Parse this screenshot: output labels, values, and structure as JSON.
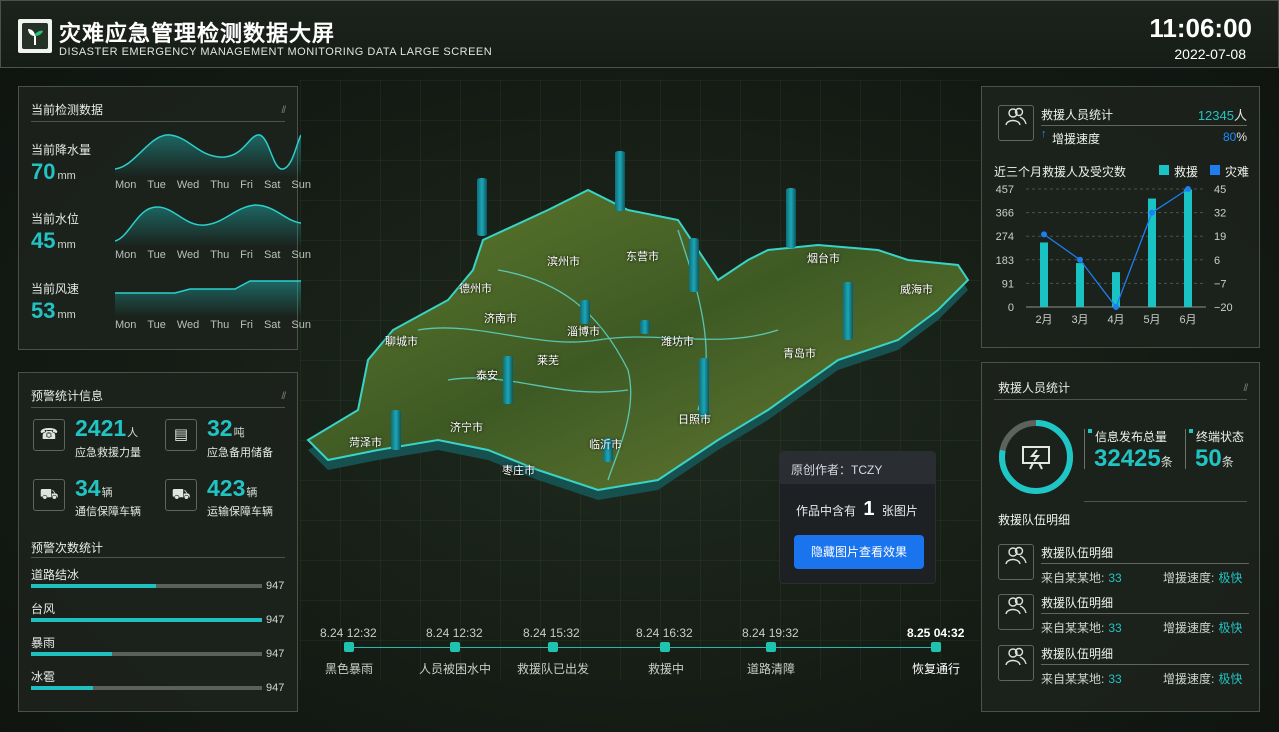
{
  "header": {
    "title": "灾难应急管理检测数据大屏",
    "subtitle": "DISASTER EMERGENCY MANAGEMENT MONITORING DATA LARGE SCREEN",
    "time": "11:06:00",
    "date": "2022-07-08"
  },
  "monitor": {
    "title": "当前检测数据",
    "deco": "//",
    "days": [
      "Mon",
      "Tue",
      "Wed",
      "Thu",
      "Fri",
      "Sat",
      "Sun"
    ],
    "items": [
      {
        "label": "当前降水量",
        "value": "70",
        "unit": "mm"
      },
      {
        "label": "当前水位",
        "value": "45",
        "unit": "mm"
      },
      {
        "label": "当前风速",
        "value": "53",
        "unit": "mm"
      }
    ]
  },
  "warning": {
    "title": "预警统计信息",
    "deco": "//",
    "stats": [
      {
        "icon": "phone-icon",
        "glyph": "☎",
        "value": "2421",
        "unit": "人",
        "label": "应急救援力量"
      },
      {
        "icon": "clipboard-icon",
        "glyph": "▤",
        "value": "32",
        "unit": "吨",
        "label": "应急备用储备"
      },
      {
        "icon": "car-icon",
        "glyph": "⛟",
        "value": "34",
        "unit": "辆",
        "label": "通信保障车辆"
      },
      {
        "icon": "truck-icon",
        "glyph": "⛟",
        "value": "423",
        "unit": "辆",
        "label": "运输保障车辆"
      }
    ],
    "count_title": "预警次数统计",
    "counts": [
      {
        "label": "道路结冰",
        "value": "947",
        "fill": 0.54
      },
      {
        "label": "台风",
        "value": "947",
        "fill": 1.0
      },
      {
        "label": "暴雨",
        "value": "947",
        "fill": 0.35
      },
      {
        "label": "冰雹",
        "value": "947",
        "fill": 0.27
      }
    ]
  },
  "map": {
    "labels": [
      "滨州市",
      "东营市",
      "烟台市",
      "威海市",
      "德州市",
      "济南市",
      "淄博市",
      "潍坊市",
      "聊城市",
      "莱芜",
      "泰安",
      "青岛市",
      "日照市",
      "菏泽市",
      "济宁市",
      "临沂市",
      "枣庄市"
    ]
  },
  "timeline": {
    "times": [
      "8.24 12:32",
      "8.24 12:32",
      "8.24 15:32",
      "8.24 16:32",
      "8.24 19:32",
      "8.25 04:32"
    ],
    "events": [
      "黑色暴雨",
      "人员被困水中",
      "救援队已出发",
      "救援中",
      "道路清障",
      "恢复通行"
    ]
  },
  "tooltip": {
    "author": "原创作者：TCZY",
    "content_prefix": "作品中含有",
    "count": "1",
    "content_suffix": "张图片",
    "button": "隐藏图片查看效果"
  },
  "rescue_stats": {
    "title": "救援人员统计",
    "value": "12345",
    "unit": "人",
    "speed_label": "增援速度",
    "speed_value": "80",
    "speed_unit": "%"
  },
  "chart_title": "近三个月救援人及受灾数",
  "chart_data": {
    "type": "bar",
    "categories": [
      "2月",
      "3月",
      "4月",
      "5月",
      "6月"
    ],
    "series": [
      {
        "name": "救援",
        "type": "bar",
        "values": [
          250,
          170,
          135,
          420,
          455
        ],
        "color": "#19c3c3"
      },
      {
        "name": "灾难",
        "type": "line",
        "values": [
          20,
          6,
          -20,
          32,
          45
        ],
        "color": "#1e7ef0"
      }
    ],
    "y_left_ticks": [
      "457",
      "366",
      "274",
      "183",
      "91",
      "0"
    ],
    "y_right_ticks": [
      "45",
      "32",
      "19",
      "6",
      "−7",
      "−20"
    ],
    "y_left_range": [
      0,
      457
    ],
    "y_right_range": [
      -20,
      45
    ]
  },
  "rescue_personnel": {
    "title": "救援人员统计",
    "deco": "//",
    "total_label": "信息发布总量",
    "total_value": "32425",
    "total_unit": "条",
    "status_label": "终端状态",
    "status_value": "50",
    "status_unit": "条",
    "ring_fill": 0.78
  },
  "teams": {
    "title": "救援队伍明细",
    "items": [
      {
        "name": "救援队伍明细",
        "from_label": "来自某某地:",
        "from_value": "33",
        "speed_label": "增援速度:",
        "speed_value": "极快"
      },
      {
        "name": "救援队伍明细",
        "from_label": "来自某某地:",
        "from_value": "33",
        "speed_label": "增援速度:",
        "speed_value": "极快"
      },
      {
        "name": "救援队伍明细",
        "from_label": "来自某某地:",
        "from_value": "33",
        "speed_label": "增援速度:",
        "speed_value": "极快"
      }
    ]
  }
}
